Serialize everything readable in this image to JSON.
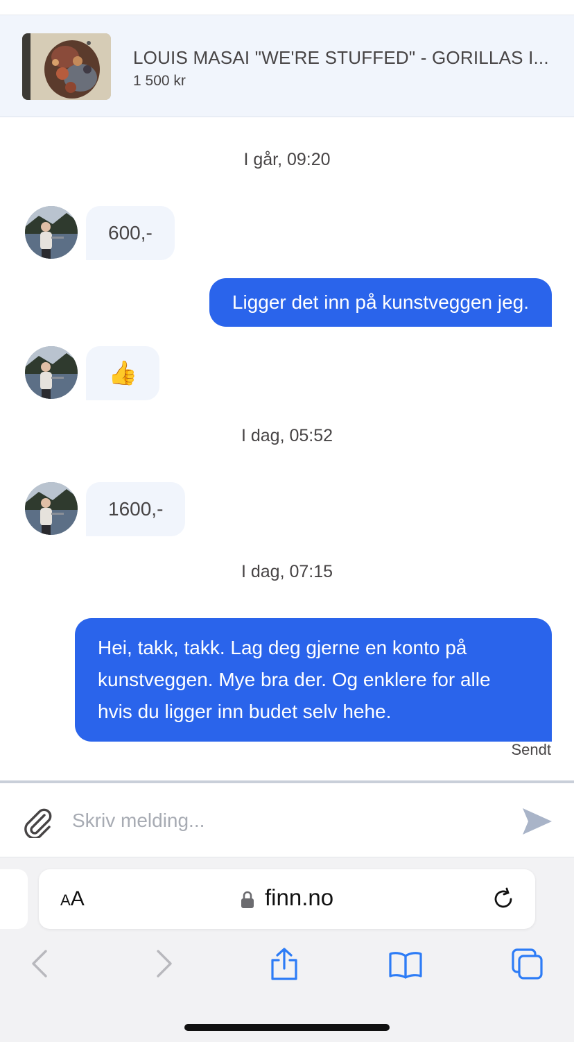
{
  "listing": {
    "title": "LOUIS MASAI \"WE'RE STUFFED\" - GORILLAS I...",
    "price": "1 500 kr"
  },
  "conversation": {
    "timestamp_1": "I går, 09:20",
    "msg_1": "600,-",
    "msg_2": "Ligger det inn på kunstveggen jeg.",
    "msg_3": "👍",
    "timestamp_2": "I dag, 05:52",
    "msg_4": "1600,-",
    "timestamp_3": "I dag, 07:15",
    "msg_5": "Hei, takk, takk. Lag deg gjerne en konto på kunstveggen. Mye bra der. Og enklere for alle hvis du ligger inn budet selv hehe.",
    "status": "Sendt"
  },
  "composer": {
    "placeholder": "Skriv melding..."
  },
  "browser": {
    "text_size_label_small": "A",
    "text_size_label_large": "A",
    "url": "finn.no"
  },
  "colors": {
    "accent": "#2a64eb",
    "incoming_bubble": "#f1f5fc",
    "text": "#474445",
    "ios_blue": "#2d7cf6"
  },
  "icons": [
    "paperclip-icon",
    "send-icon",
    "lock-icon",
    "reload-icon",
    "back-icon",
    "forward-icon",
    "share-icon",
    "bookmarks-icon",
    "tabs-icon"
  ]
}
